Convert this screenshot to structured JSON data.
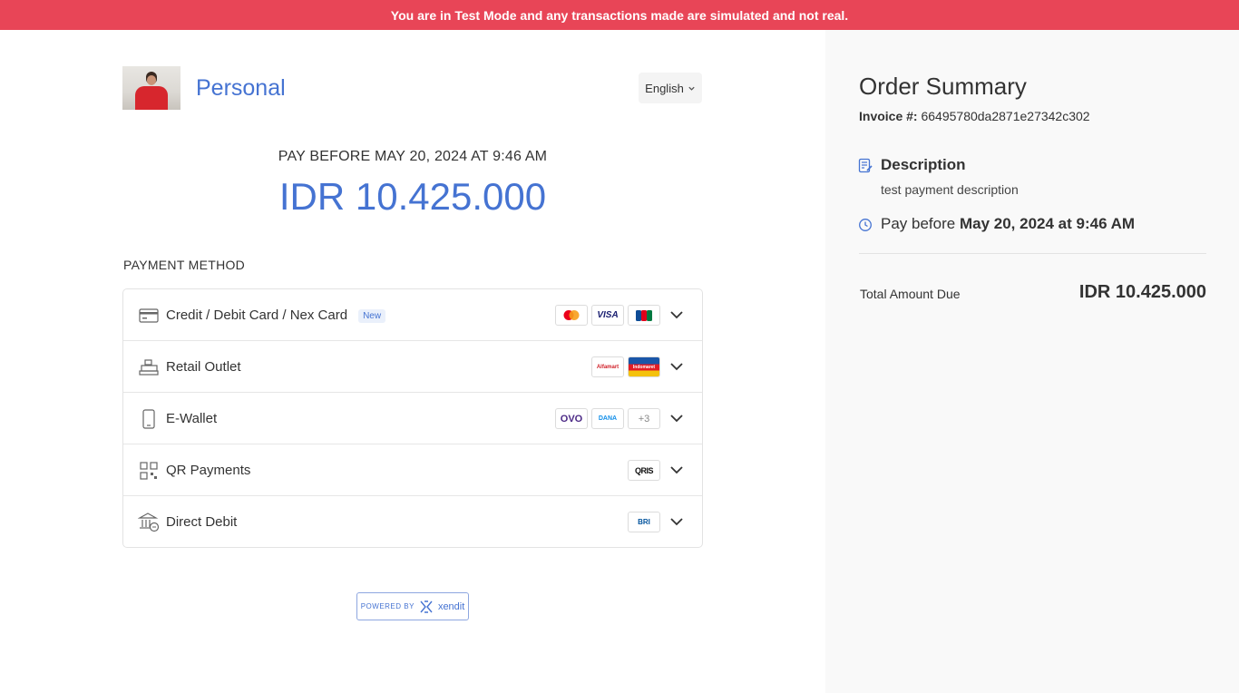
{
  "banner": {
    "text": "You are in Test Mode and any transactions made are simulated and not real."
  },
  "merchant": {
    "name": "Personal"
  },
  "language": {
    "selected": "English"
  },
  "payment": {
    "pay_before": "PAY BEFORE MAY 20, 2024 AT 9:46 AM",
    "amount": "IDR 10.425.000",
    "method_title": "PAYMENT METHOD",
    "methods": [
      {
        "label": "Credit / Debit Card / Nex Card",
        "badge": "New",
        "icon": "credit-card-icon",
        "logos": [
          "mastercard",
          "VISA",
          "JCB"
        ]
      },
      {
        "label": "Retail Outlet",
        "icon": "cash-register-icon",
        "logos": [
          "Alfamart",
          "Indomaret"
        ]
      },
      {
        "label": "E-Wallet",
        "icon": "mobile-phone-icon",
        "logos": [
          "OVO",
          "DANA",
          "+3"
        ]
      },
      {
        "label": "QR Payments",
        "icon": "qr-code-icon",
        "logos": [
          "QRIS"
        ]
      },
      {
        "label": "Direct Debit",
        "icon": "bank-icon",
        "logos": [
          "BRI"
        ]
      }
    ]
  },
  "powered": {
    "prefix": "POWERED BY",
    "brand": "xendit"
  },
  "summary": {
    "title": "Order Summary",
    "invoice_label": "Invoice #:",
    "invoice_number": "66495780da2871e27342c302",
    "description_title": "Description",
    "description_text": "test payment description",
    "pay_before_prefix": "Pay before",
    "pay_before_value": "May 20, 2024 at 9:46 AM",
    "total_label": "Total Amount Due",
    "total_value": "IDR 10.425.000"
  },
  "colors": {
    "accent": "#4573d2",
    "banner": "#e84557",
    "sidebar": "#f9f9f9"
  }
}
